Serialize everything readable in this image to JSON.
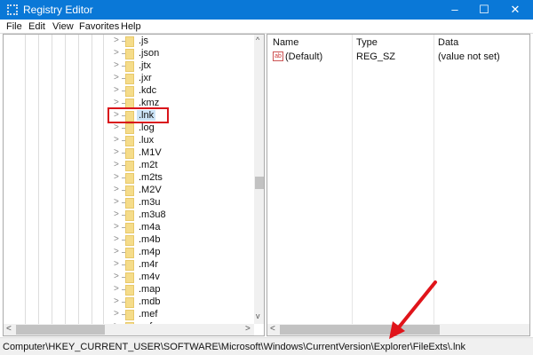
{
  "window": {
    "title": "Registry Editor",
    "minimize": "–",
    "maximize": "☐",
    "close": "✕"
  },
  "menu": [
    "File",
    "Edit",
    "View",
    "Favorites",
    "Help"
  ],
  "tree": {
    "items": [
      ".js",
      ".json",
      ".jtx",
      ".jxr",
      ".kdc",
      ".kmz",
      ".lnk",
      ".log",
      ".lux",
      ".M1V",
      ".m2t",
      ".m2ts",
      ".M2V",
      ".m3u",
      ".m3u8",
      ".m4a",
      ".m4b",
      ".m4p",
      ".m4r",
      ".m4v",
      ".map",
      ".mdb",
      ".mef",
      ".mfu"
    ],
    "selected": ".lnk"
  },
  "list": {
    "columns": [
      "Name",
      "Type",
      "Data"
    ],
    "rows": [
      {
        "name": "(Default)",
        "type": "REG_SZ",
        "data": "(value not set)"
      }
    ]
  },
  "status": "Computer\\HKEY_CURRENT_USER\\SOFTWARE\\Microsoft\\Windows\\CurrentVersion\\Explorer\\FileExts\\.lnk",
  "colors": {
    "titlebar": "#0a78d7",
    "highlight": "#d9151b"
  }
}
